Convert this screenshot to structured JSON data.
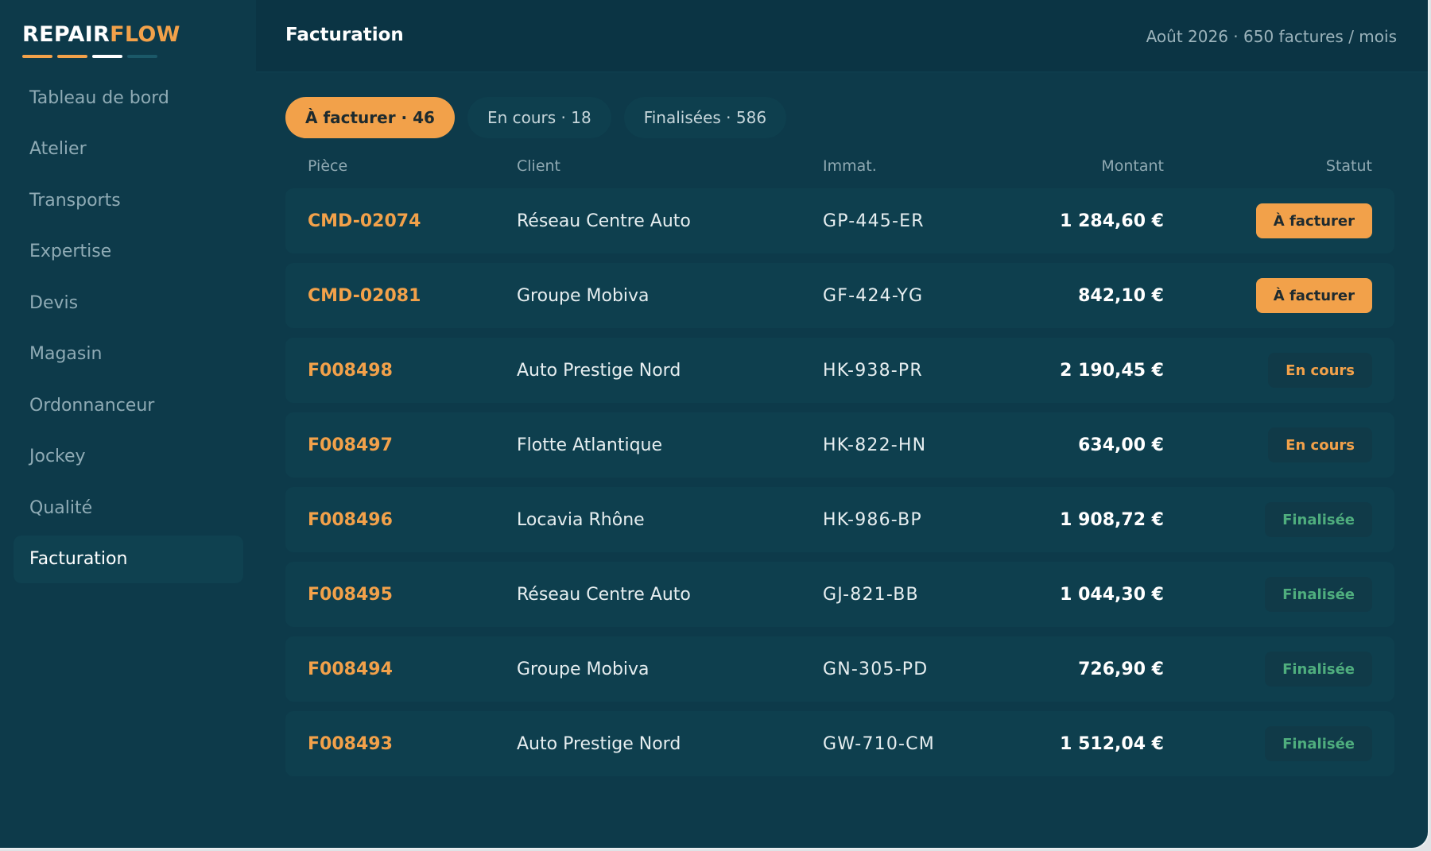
{
  "app": {
    "logo_part1": "REPAIR",
    "logo_part2": "FLOW",
    "logo_bar_colors": [
      "#f2a14a",
      "#f2a14a",
      "#ffffff",
      "#1b5868"
    ]
  },
  "sidebar": {
    "items": [
      {
        "label": "Tableau de bord",
        "active": false
      },
      {
        "label": "Atelier",
        "active": false
      },
      {
        "label": "Transports",
        "active": false
      },
      {
        "label": "Expertise",
        "active": false
      },
      {
        "label": "Devis",
        "active": false
      },
      {
        "label": "Magasin",
        "active": false
      },
      {
        "label": "Ordonnanceur",
        "active": false
      },
      {
        "label": "Jockey",
        "active": false
      },
      {
        "label": "Qualité",
        "active": false
      },
      {
        "label": "Facturation",
        "active": true
      }
    ]
  },
  "header": {
    "title": "Facturation",
    "period": "Août 2026 · 650 factures / mois"
  },
  "tabs": [
    {
      "label": "À facturer · 46",
      "active": true
    },
    {
      "label": "En cours · 18",
      "active": false
    },
    {
      "label": "Finalisées · 586",
      "active": false
    }
  ],
  "table": {
    "columns": {
      "piece": "Pièce",
      "client": "Client",
      "immat": "Immat.",
      "amount": "Montant",
      "status": "Statut"
    },
    "rows": [
      {
        "piece": "CMD-02074",
        "client": "Réseau Centre Auto",
        "immat": "GP-445-ER",
        "amount": "1 284,60 €",
        "status": "À facturer",
        "status_kind": "todo"
      },
      {
        "piece": "CMD-02081",
        "client": "Groupe Mobiva",
        "immat": "GF-424-YG",
        "amount": "842,10 €",
        "status": "À facturer",
        "status_kind": "todo"
      },
      {
        "piece": "F008498",
        "client": "Auto Prestige Nord",
        "immat": "HK-938-PR",
        "amount": "2 190,45 €",
        "status": "En cours",
        "status_kind": "progress"
      },
      {
        "piece": "F008497",
        "client": "Flotte Atlantique",
        "immat": "HK-822-HN",
        "amount": "634,00 €",
        "status": "En cours",
        "status_kind": "progress"
      },
      {
        "piece": "F008496",
        "client": "Locavia Rhône",
        "immat": "HK-986-BP",
        "amount": "1 908,72 €",
        "status": "Finalisée",
        "status_kind": "done"
      },
      {
        "piece": "F008495",
        "client": "Réseau Centre Auto",
        "immat": "GJ-821-BB",
        "amount": "1 044,30 €",
        "status": "Finalisée",
        "status_kind": "done"
      },
      {
        "piece": "F008494",
        "client": "Groupe Mobiva",
        "immat": "GN-305-PD",
        "amount": "726,90 €",
        "status": "Finalisée",
        "status_kind": "done"
      },
      {
        "piece": "F008493",
        "client": "Auto Prestige Nord",
        "immat": "GW-710-CM",
        "amount": "1 512,04 €",
        "status": "Finalisée",
        "status_kind": "done"
      }
    ]
  }
}
